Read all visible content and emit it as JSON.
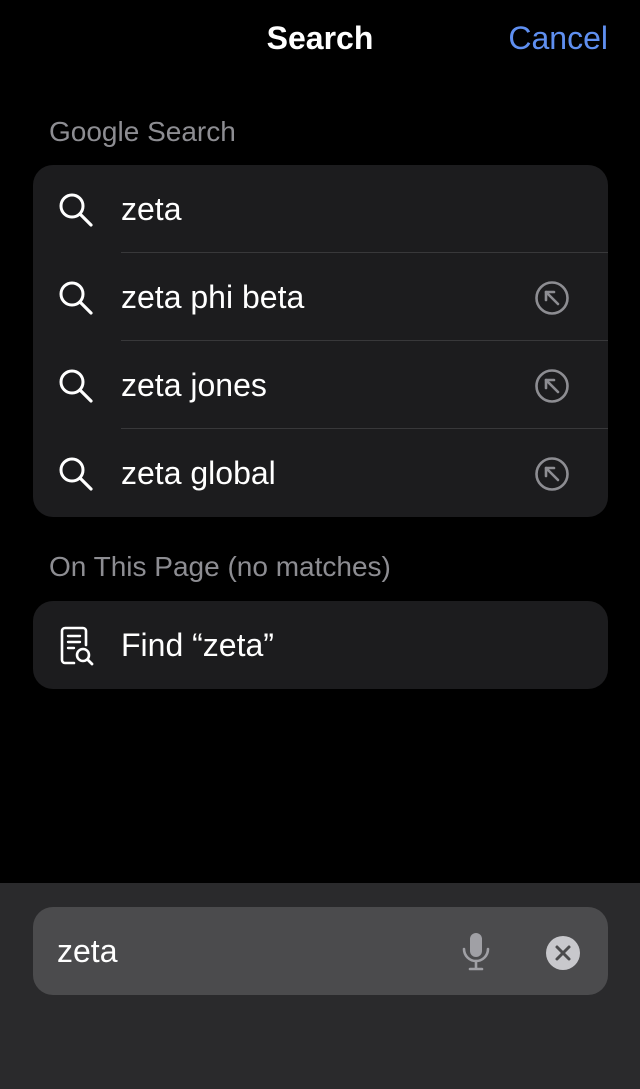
{
  "nav": {
    "title": "Search",
    "cancel_label": "Cancel"
  },
  "google_section": {
    "header": "Google Search",
    "suggestions": [
      {
        "text": "zeta",
        "has_fill_arrow": false
      },
      {
        "text": "zeta phi beta",
        "has_fill_arrow": true
      },
      {
        "text": "zeta jones",
        "has_fill_arrow": true
      },
      {
        "text": "zeta global",
        "has_fill_arrow": true
      }
    ]
  },
  "on_page_section": {
    "header": "On This Page (no matches)",
    "find_label": "Find “zeta”"
  },
  "search_bar": {
    "value": "zeta"
  },
  "icons": {
    "suggestion": "magnifier-icon",
    "fill": "arrow-up-left-circle-icon",
    "find": "document-search-icon",
    "mic": "microphone-icon",
    "clear": "clear-circle-icon"
  },
  "colors": {
    "accent": "#5f8ff0",
    "background": "#000000",
    "group_background": "#1c1c1e",
    "secondary_text": "#8d8d92"
  }
}
